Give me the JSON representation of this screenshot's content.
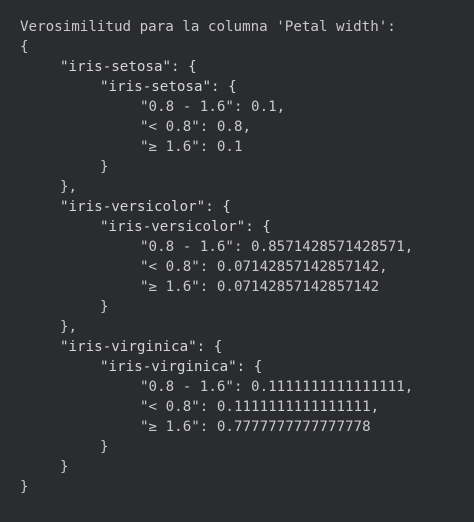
{
  "output": {
    "header": "Verosimilitud para la columna 'Petal width':",
    "classes": [
      {
        "outer": "\"iris-setosa\": {",
        "inner": "\"iris-setosa\": {",
        "values": [
          "\"0.8 - 1.6\": 0.1,",
          "\"< 0.8\": 0.8,",
          "\"≥ 1.6\": 0.1"
        ],
        "close_inner": "}",
        "close_outer": "},"
      },
      {
        "outer": "\"iris-versicolor\": {",
        "inner": "\"iris-versicolor\": {",
        "values": [
          "\"0.8 - 1.6\": 0.8571428571428571,",
          "\"< 0.8\": 0.07142857142857142,",
          "\"≥ 1.6\": 0.07142857142857142"
        ],
        "close_inner": "}",
        "close_outer": "},"
      },
      {
        "outer": "\"iris-virginica\": {",
        "inner": "\"iris-virginica\": {",
        "values": [
          "\"0.8 - 1.6\": 0.1111111111111111,",
          "\"< 0.8\": 0.1111111111111111,",
          "\"≥ 1.6\": 0.7777777777777778"
        ],
        "close_inner": "}",
        "close_outer": "}"
      }
    ],
    "open_brace": "{",
    "close_brace": "}"
  }
}
